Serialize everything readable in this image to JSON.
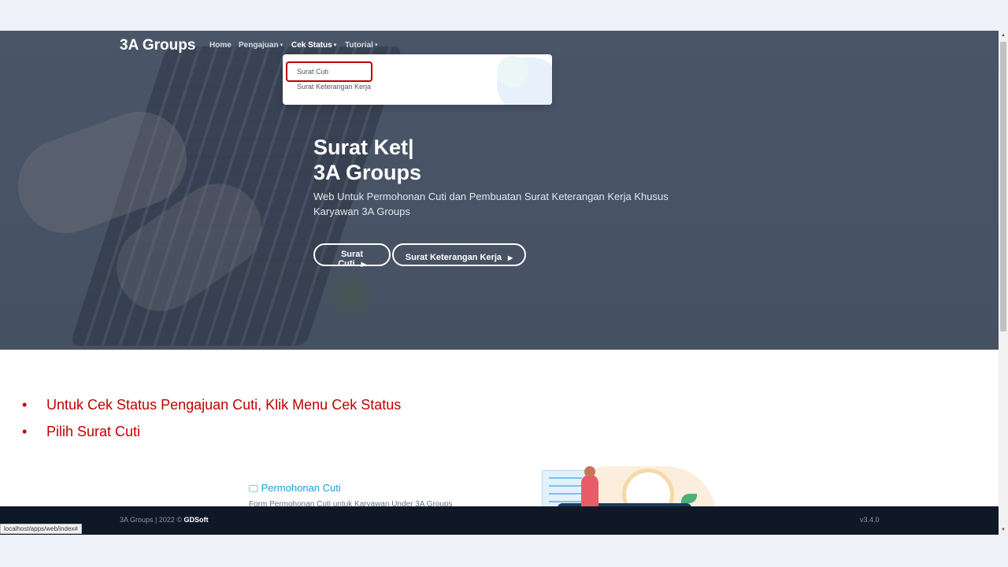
{
  "navbar": {
    "brand": "3A Groups",
    "items": [
      {
        "label": "Home",
        "has_caret": false
      },
      {
        "label": "Pengajuan",
        "has_caret": true
      },
      {
        "label": "Cek Status",
        "has_caret": true
      },
      {
        "label": "Tutorial",
        "has_caret": true
      }
    ],
    "caret": "▾"
  },
  "dropdown": {
    "items": [
      "Surat Cuti",
      "Surat Keterangan Kerja"
    ],
    "highlight_color": "#c00000"
  },
  "hero": {
    "title_prefix": "Surat ",
    "title_bold": "Ket|",
    "title_line2": "3A Groups",
    "subtitle": "Web Untuk Permohonan Cuti dan Pembuatan Surat Keterangan Kerja Khusus Karyawan 3A Groups",
    "buttons": [
      {
        "label": "Surat Cuti",
        "icon": "▶"
      },
      {
        "label": "Surat Keterangan Kerja",
        "icon": "▶"
      }
    ]
  },
  "instructions": {
    "bullet": "•",
    "items": [
      "Untuk Cek Status Pengajuan Cuti, Klik  Menu Cek Status",
      "Pilih  Surat Cuti"
    ],
    "color": "#c00000"
  },
  "service": {
    "icon": "🖵",
    "title": "Permohonan Cuti",
    "description": "Form Permohonan Cuti untuk Karyawan Under 3A Groups",
    "color": "#17a2d8"
  },
  "footer": {
    "copyright": "3A Groups | 2022 © ",
    "company": "GDSoft",
    "version": "v3.4.0"
  },
  "status_bar": {
    "url": "localhost/apps/web/index#"
  },
  "scrollbar": {
    "up": "▲",
    "down": "▼"
  }
}
